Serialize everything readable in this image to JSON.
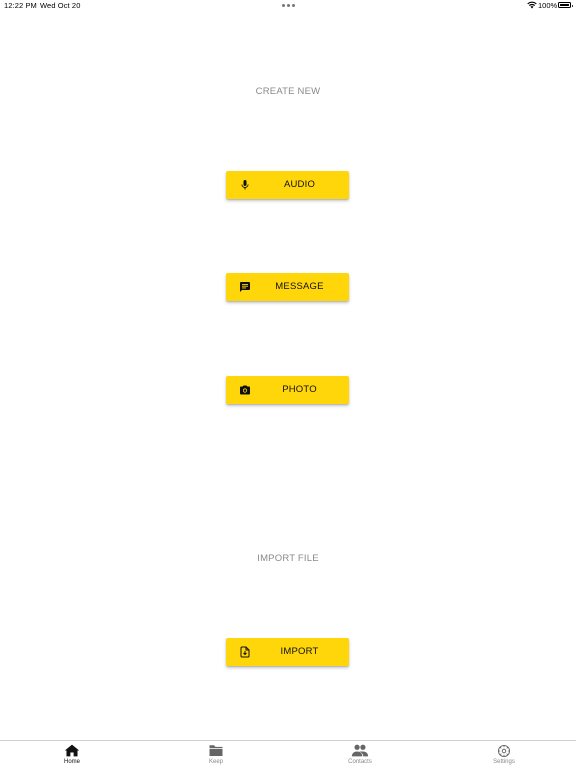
{
  "status_bar": {
    "time": "12:22 PM",
    "date": "Wed Oct 20",
    "battery": "100%",
    "icons": [
      "multitask-dots-icon",
      "wifi-icon",
      "battery-icon"
    ]
  },
  "create_section": {
    "label": "CREATE NEW",
    "buttons": [
      {
        "label": "AUDIO",
        "icon": "microphone-icon"
      },
      {
        "label": "MESSAGE",
        "icon": "message-icon"
      },
      {
        "label": "PHOTO",
        "icon": "camera-icon"
      }
    ]
  },
  "import_section": {
    "label": "IMPORT FILE",
    "button": {
      "label": "IMPORT",
      "icon": "file-import-icon"
    }
  },
  "tab_bar": {
    "tabs": [
      {
        "label": "Home",
        "icon": "home-icon",
        "active": true
      },
      {
        "label": "Keep",
        "icon": "folder-icon",
        "active": false
      },
      {
        "label": "Contacts",
        "icon": "contacts-icon",
        "active": false
      },
      {
        "label": "Settings",
        "icon": "settings-icon",
        "active": false
      }
    ]
  },
  "colors": {
    "accent": "#FFD60A",
    "label_gray": "#8a8a8a",
    "active_tab": "#111111",
    "inactive_tab": "#666666"
  }
}
